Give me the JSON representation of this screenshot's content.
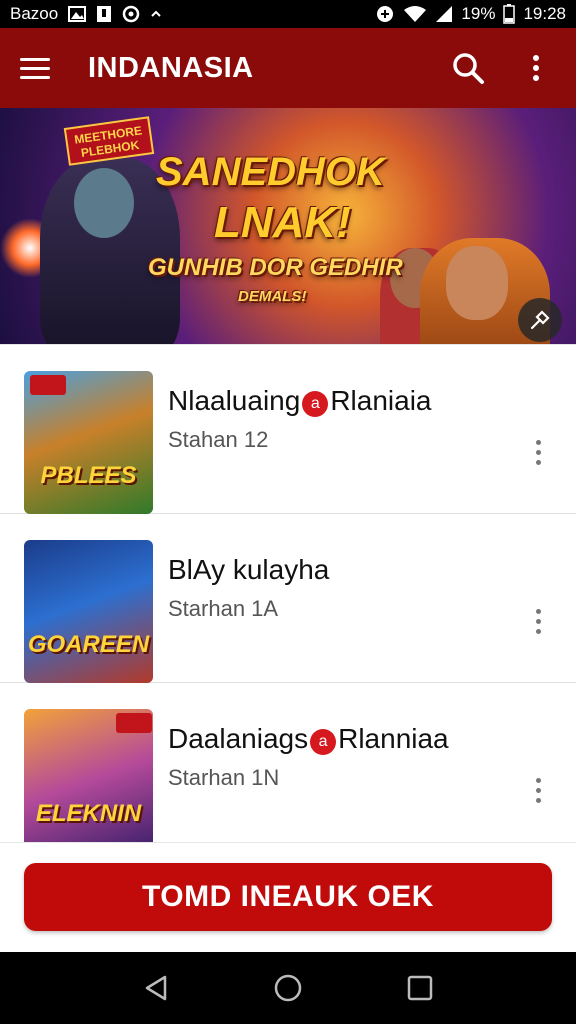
{
  "status_bar": {
    "carrier": "Bazoo",
    "battery_percent": "19%",
    "time": "19:28"
  },
  "app_bar": {
    "title": "INDANASIA",
    "icons": [
      "menu-icon",
      "search-icon",
      "more-vert-icon"
    ]
  },
  "banner": {
    "badge": "MEETHORE\nPLEBHOK",
    "line1": "SANEDHOK",
    "line2": "LNAK!",
    "line3": "GUNHIB DOR GEDHIR",
    "line4": "DEMALS!",
    "colors": {
      "accent": "#ffcc2e"
    }
  },
  "list": {
    "items": [
      {
        "title_a": "Nlaaluaing",
        "title_badge": "a",
        "title_b": "Rlaniaia",
        "subtitle": "Stahan 12",
        "thumb_label": "PBLEES",
        "thumb_bg": "linear-gradient(160deg,#4aa0e0 0%,#c8802a 45%,#2f7a2a 100%)"
      },
      {
        "title_a": "BlAy kulayha",
        "title_badge": "",
        "title_b": "",
        "subtitle": "Starhan 1A",
        "thumb_label": "GOAREEN",
        "thumb_bg": "linear-gradient(160deg,#1b3c8a 0%,#2c6fd0 45%,#b3392a 100%)"
      },
      {
        "title_a": "Daalaniags",
        "title_badge": "a",
        "title_b": "Rlanniaa",
        "subtitle": "Starhan 1N",
        "thumb_label": "ELEKNIN",
        "thumb_bg": "linear-gradient(160deg,#f2a23a 0%,#b54a9a 50%,#3a1f6a 100%)"
      }
    ]
  },
  "cta": {
    "label": "TOMD INEAUK OEK",
    "color": "#c10a0a"
  },
  "nav_bar": {
    "icons": [
      "back-icon",
      "home-icon",
      "recents-icon"
    ]
  }
}
